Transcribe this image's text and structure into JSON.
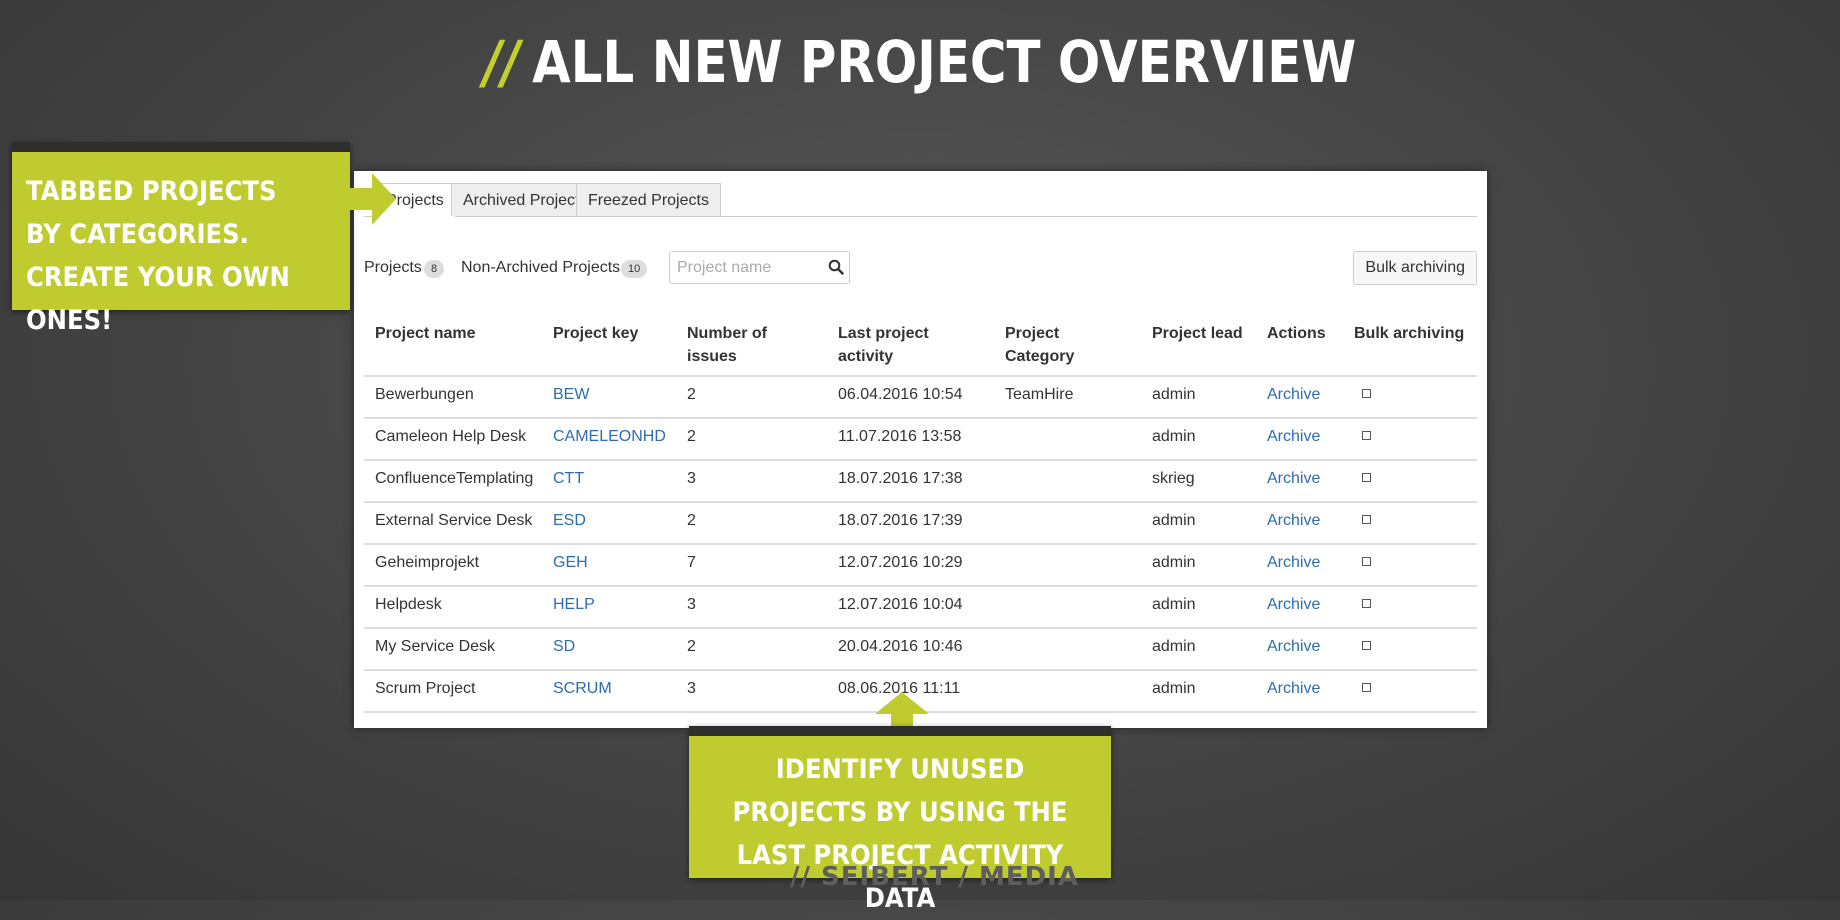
{
  "headline": {
    "slashes": "//",
    "text": "ALL NEW PROJECT OVERVIEW"
  },
  "tabs": [
    {
      "label": "Projects",
      "active": true
    },
    {
      "label": "Archived Projects",
      "active": false
    },
    {
      "label": "Freezed Projects",
      "active": false
    }
  ],
  "toolbar": {
    "projects_label": "Projects",
    "projects_count": "8",
    "non_archived_label": "Non-Archived Projects",
    "non_archived_count": "10",
    "search_placeholder": "Project name",
    "search_value": "",
    "search_icon": "search-icon",
    "bulk_button": "Bulk archiving"
  },
  "table": {
    "headers": {
      "name": "Project name",
      "key": "Project key",
      "issues": "Number of issues",
      "activity": "Last project activity",
      "category": "Project Category",
      "lead": "Project lead",
      "actions": "Actions",
      "bulk": "Bulk archiving"
    },
    "rows": [
      {
        "name": "Bewerbungen",
        "key": "BEW",
        "issues": "2",
        "activity": "06.04.2016 10:54",
        "category": "TeamHire",
        "lead": "admin",
        "action": "Archive",
        "checked": false
      },
      {
        "name": "Cameleon Help Desk",
        "key": "CAMELEONHD",
        "issues": "2",
        "activity": "11.07.2016 13:58",
        "category": "",
        "lead": "admin",
        "action": "Archive",
        "checked": false
      },
      {
        "name": "ConfluenceTemplating",
        "key": "CTT",
        "issues": "3",
        "activity": "18.07.2016 17:38",
        "category": "",
        "lead": "skrieg",
        "action": "Archive",
        "checked": false
      },
      {
        "name": "External Service Desk",
        "key": "ESD",
        "issues": "2",
        "activity": "18.07.2016 17:39",
        "category": "",
        "lead": "admin",
        "action": "Archive",
        "checked": false
      },
      {
        "name": "Geheimprojekt",
        "key": "GEH",
        "issues": "7",
        "activity": "12.07.2016 10:29",
        "category": "",
        "lead": "admin",
        "action": "Archive",
        "checked": false
      },
      {
        "name": "Helpdesk",
        "key": "HELP",
        "issues": "3",
        "activity": "12.07.2016 10:04",
        "category": "",
        "lead": "admin",
        "action": "Archive",
        "checked": false
      },
      {
        "name": "My Service Desk",
        "key": "SD",
        "issues": "2",
        "activity": "20.04.2016 10:46",
        "category": "",
        "lead": "admin",
        "action": "Archive",
        "checked": false
      },
      {
        "name": "Scrum Project",
        "key": "SCRUM",
        "issues": "3",
        "activity": "08.06.2016 11:11",
        "category": "",
        "lead": "admin",
        "action": "Archive",
        "checked": false
      }
    ]
  },
  "callouts": {
    "left": "TABBED PROJECTS BY CATEGORIES. CREATE YOUR OWN ONES!",
    "bottom": "IDENTIFY UNUSED PROJECTS BY USING THE LAST PROJECT ACTIVITY DATA"
  },
  "watermark": "// SEIBERT / MEDIA",
  "colors": {
    "accent": "#bfcb2e",
    "link": "#2d6cb0",
    "background": "#474747"
  }
}
